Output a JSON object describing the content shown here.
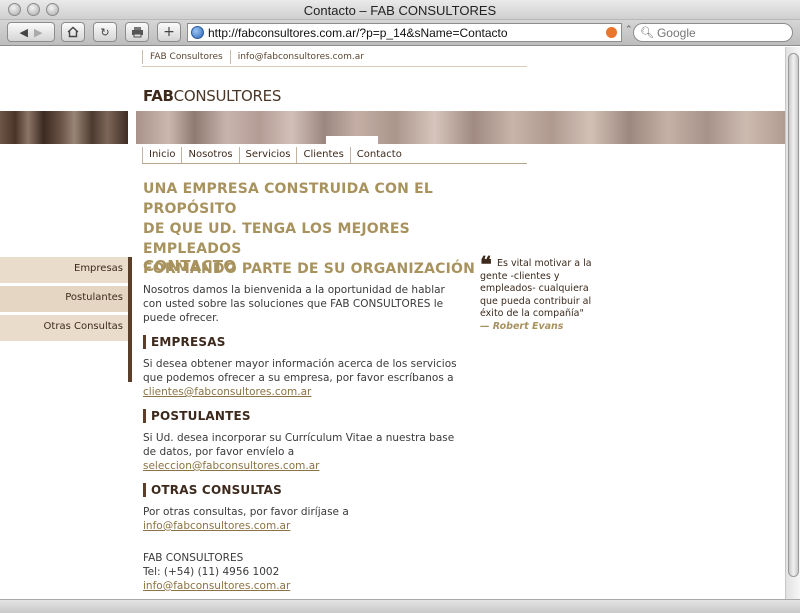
{
  "window": {
    "title": "Contacto – FAB CONSULTORES"
  },
  "toolbar": {
    "url": "http://fabconsultores.com.ar/?p=p_14&sName=Contacto",
    "search_placeholder": "Google",
    "buttons": [
      "back",
      "forward",
      "home",
      "reload",
      "print",
      "add-bookmark"
    ]
  },
  "header": {
    "toplinks": [
      "FAB Consultores",
      "info@fabconsultores.com.ar"
    ],
    "logo_bold": "FAB",
    "logo_rest": "CONSULTORES"
  },
  "nav": {
    "items": [
      "Inicio",
      "Nosotros",
      "Servicios",
      "Clientes",
      "Contacto"
    ],
    "active": "Contacto"
  },
  "headline": {
    "lines": [
      "UNA EMPRESA CONSTRUIDA CON EL PROPÓSITO",
      "DE QUE UD. TENGA LOS MEJORES EMPLEADOS",
      "FORMANDO PARTE DE SU ORGANIZACIÓN"
    ]
  },
  "sidebar": {
    "items": [
      "Empresas",
      "Postulantes",
      "Otras Consultas"
    ]
  },
  "content": {
    "title": "CONTACTO",
    "intro": "Nosotros damos la bienvenida a la oportunidad de hablar con usted sobre las soluciones que FAB CONSULTORES le puede ofrecer.",
    "sections": [
      {
        "heading": "EMPRESAS",
        "text": "Si desea obtener mayor información acerca de los servicios que podemos ofrecer a su empresa, por favor escríbanos a",
        "email": "clientes@fabconsultores.com.ar"
      },
      {
        "heading": "POSTULANTES",
        "text": "Si Ud. desea incorporar su Currículum Vitae a nuestra base de datos, por favor envíelo a",
        "email": "seleccion@fabconsultores.com.ar"
      },
      {
        "heading": "OTRAS CONSULTAS",
        "text": "Por otras consultas, por favor diríjase a",
        "email": "info@fabconsultores.com.ar"
      }
    ],
    "footer": {
      "company": "FAB CONSULTORES",
      "phone": "Tel: (+54) (11) 4956 1002",
      "email": "info@fabconsultores.com.ar"
    }
  },
  "quote": {
    "lines": [
      "Es vital motivar a la",
      "gente -clientes y",
      "empleados- cualquiera",
      "que pueda contribuir al",
      "éxito de la compañía\""
    ],
    "author": "— Robert Evans"
  }
}
